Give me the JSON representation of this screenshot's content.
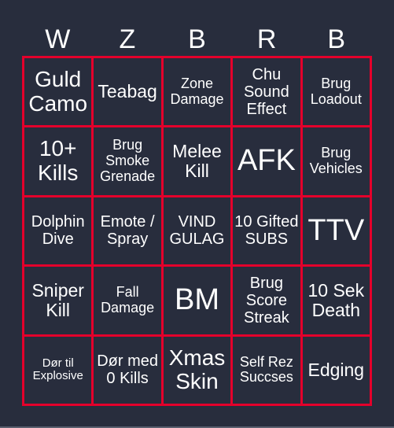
{
  "header": {
    "letters": [
      "W",
      "Z",
      "B",
      "R",
      "B"
    ]
  },
  "board": {
    "cells": [
      {
        "text": "Guld Camo",
        "size": "lg"
      },
      {
        "text": "Teabag",
        "size": "md"
      },
      {
        "text": "Zone Damage",
        "size": "xs"
      },
      {
        "text": "Chu Sound Effect",
        "size": "sm"
      },
      {
        "text": "Brug Loadout",
        "size": "xs"
      },
      {
        "text": "10+ Kills",
        "size": "lg"
      },
      {
        "text": "Brug Smoke Grenade",
        "size": "xs"
      },
      {
        "text": "Melee Kill",
        "size": "md"
      },
      {
        "text": "AFK",
        "size": "xl"
      },
      {
        "text": "Brug Vehicles",
        "size": "xs"
      },
      {
        "text": "Dolphin Dive",
        "size": "sm"
      },
      {
        "text": "Emote / Spray",
        "size": "sm"
      },
      {
        "text": "VIND GULAG",
        "size": "sm"
      },
      {
        "text": "10 Gifted SUBS",
        "size": "sm"
      },
      {
        "text": "TTV",
        "size": "xl"
      },
      {
        "text": "Sniper Kill",
        "size": "md"
      },
      {
        "text": "Fall Damage",
        "size": "xs"
      },
      {
        "text": "BM",
        "size": "xl"
      },
      {
        "text": "Brug Score Streak",
        "size": "sm"
      },
      {
        "text": "10 Sek Death",
        "size": "md"
      },
      {
        "text": "Dør til Explosive",
        "size": "xxs"
      },
      {
        "text": "Dør med 0 Kills",
        "size": "sm"
      },
      {
        "text": "Xmas Skin",
        "size": "lg"
      },
      {
        "text": "Self Rez Succses",
        "size": "xs"
      },
      {
        "text": "Edging",
        "size": "md"
      }
    ]
  },
  "colors": {
    "background": "#282d3d",
    "grid": "#e4002b",
    "text": "#ffffff"
  }
}
